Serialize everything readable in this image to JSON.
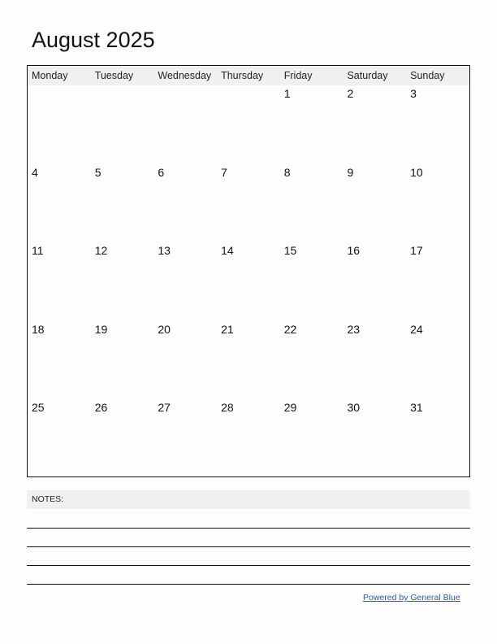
{
  "calendar": {
    "title": "August 2025",
    "weekdays": [
      "Monday",
      "Tuesday",
      "Wednesday",
      "Thursday",
      "Friday",
      "Saturday",
      "Sunday"
    ],
    "weeks": [
      [
        "",
        "",
        "",
        "",
        "1",
        "2",
        "3"
      ],
      [
        "4",
        "5",
        "6",
        "7",
        "8",
        "9",
        "10"
      ],
      [
        "11",
        "12",
        "13",
        "14",
        "15",
        "16",
        "17"
      ],
      [
        "18",
        "19",
        "20",
        "21",
        "22",
        "23",
        "24"
      ],
      [
        "25",
        "26",
        "27",
        "28",
        "29",
        "30",
        "31"
      ]
    ]
  },
  "notes": {
    "label": "NOTES:",
    "line_count": 4
  },
  "footer": {
    "link_text": "Powered by General Blue",
    "link_color": "#1f5fb0"
  }
}
